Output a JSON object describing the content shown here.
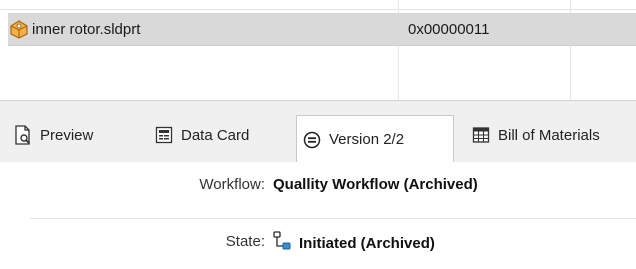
{
  "file_list": {
    "rows": [
      {
        "name": "inner rotor.sldprt",
        "id": "0x00000011",
        "icon": "sldprt-part-icon"
      }
    ]
  },
  "tabs": [
    {
      "label": "Preview",
      "icon": "preview-icon"
    },
    {
      "label": "Data Card",
      "icon": "data-card-icon"
    },
    {
      "label": "Version 2/2",
      "icon": "version-icon",
      "active": true
    },
    {
      "label": "Bill of Materials",
      "icon": "bill-of-materials-icon"
    }
  ],
  "details": {
    "workflow_label": "Workflow:",
    "workflow_value": "Quallity Workflow (Archived)",
    "state_label": "State:",
    "state_value": "Initiated (Archived)",
    "state_icon": "workflow-state-icon"
  },
  "colors": {
    "selected_row": "#d9d9d9",
    "tab_strip": "#f0f0f0",
    "part_icon": "#e8a23a"
  }
}
